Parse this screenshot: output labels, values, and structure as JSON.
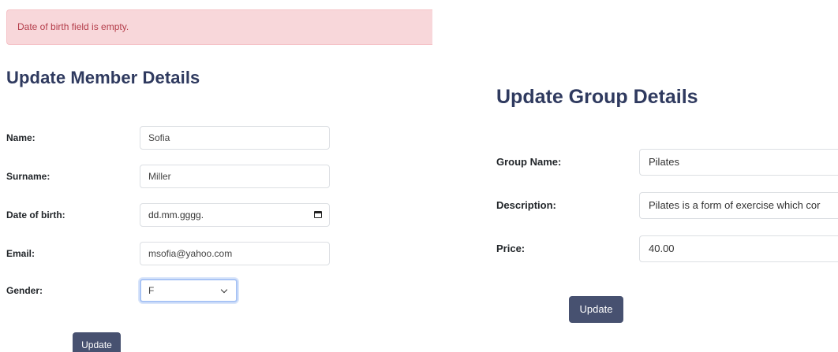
{
  "member_panel": {
    "alert_text": "Date of birth field is empty.",
    "title": "Update Member Details",
    "fields": [
      {
        "label": "Name:",
        "value": "Sofia"
      },
      {
        "label": "Surname:",
        "value": "Miller"
      },
      {
        "label": "Date of birth:",
        "value": "dd.mm.gggg."
      },
      {
        "label": "Email:",
        "value": "msofia@yahoo.com"
      },
      {
        "label": "Gender:",
        "value": "F"
      }
    ],
    "update_label": "Update"
  },
  "group_panel": {
    "title": "Update Group Details",
    "fields": [
      {
        "label": "Group Name:",
        "value": "Pilates"
      },
      {
        "label": "Description:",
        "value": "Pilates is a form of exercise which cor"
      },
      {
        "label": "Price:",
        "value": "40.00"
      }
    ],
    "update_label": "Update"
  },
  "colors": {
    "accent": "#475170",
    "heading": "#2f3a5f",
    "alert_background": "#f8d7da",
    "alert_text": "#b43d4a",
    "focus_border": "#a9c4f5"
  }
}
